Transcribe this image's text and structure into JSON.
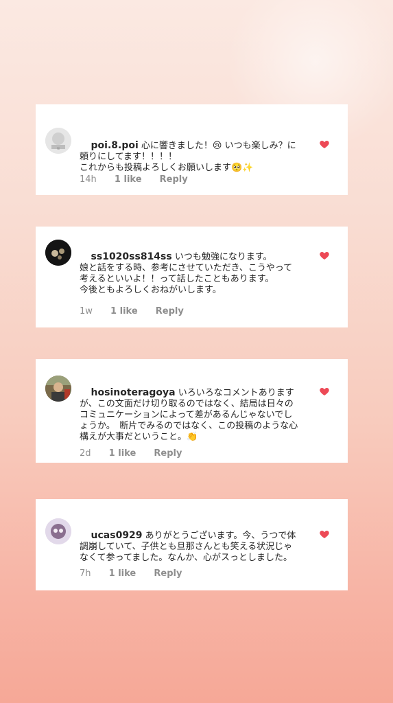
{
  "accent": "#ed4956",
  "comments": [
    {
      "username": "poi.8.poi",
      "text": " 心に響きました！😢 いつも楽しみ？に頼りにしてます！！！！\nこれからも投稿よろしくお願いします🥺✨",
      "time": "14h",
      "likes": "1 like",
      "reply": "Reply"
    },
    {
      "username": "ss1020ss814ss",
      "text": " いつも勉強になります。\n娘と話をする時、参考にさせていただき、こうやって考えるといいよ！！って話したこともあります。\n今後ともよろしくおねがいします。",
      "time": "1w",
      "likes": "1 like",
      "reply": "Reply"
    },
    {
      "username": "hosinoteragoya",
      "text": " いろいろなコメントありますが、この文面だけ切り取るのではなく、結局は日々のコミュニケーションによって差があるんじゃないでしょうか。　断片でみるのではなく、この投稿のような心構えが大事だということ。👏",
      "time": "2d",
      "likes": "1 like",
      "reply": "Reply"
    },
    {
      "username": "ucas0929",
      "text": " ありがとうございます。今、うつで体調崩していて、子供とも旦那さんとも笑える状況じゃなくて参ってました。なんか、心がスっとしました。",
      "time": "7h",
      "likes": "1 like",
      "reply": "Reply"
    }
  ]
}
